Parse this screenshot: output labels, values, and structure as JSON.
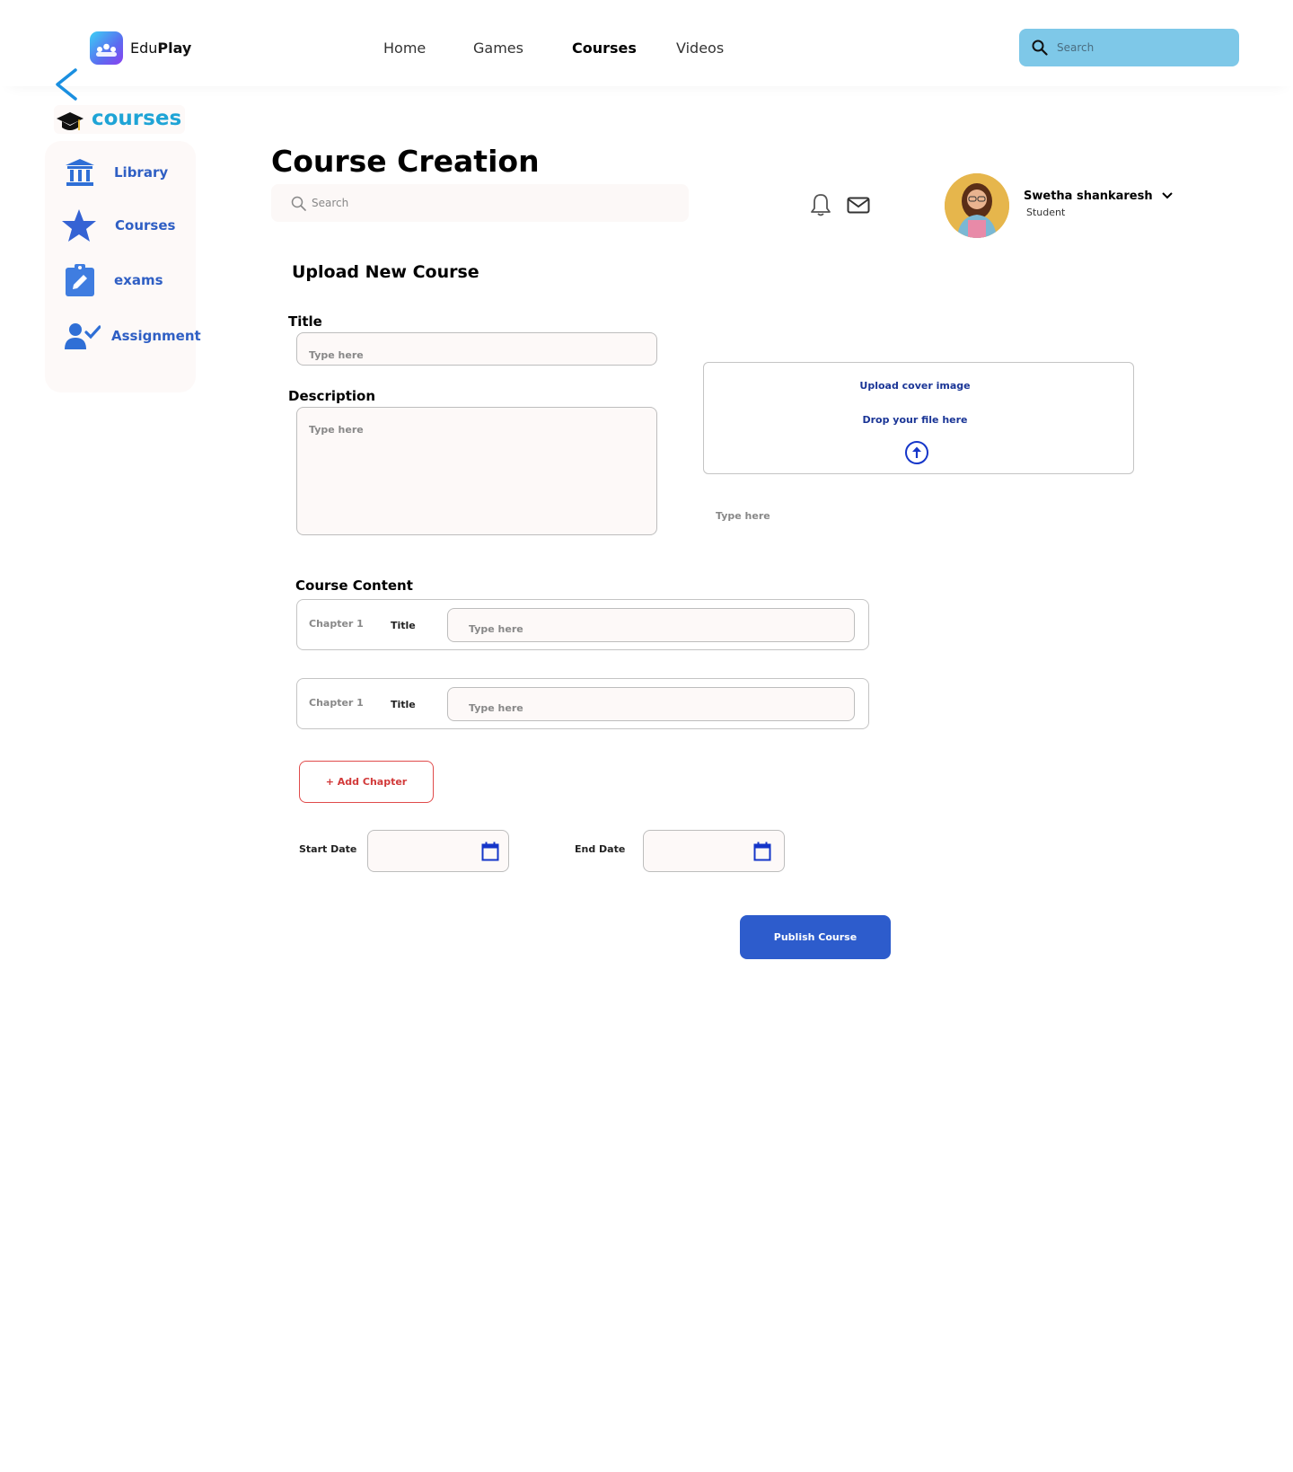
{
  "brand": {
    "name_light": "Edu",
    "name_bold": "Play"
  },
  "nav": {
    "items": [
      "Home",
      "Games",
      "Courses",
      "Videos"
    ],
    "active": "Courses"
  },
  "top_search": {
    "placeholder": "Search"
  },
  "section": {
    "title": "courses"
  },
  "sidebar": {
    "items": [
      {
        "label": "Library",
        "icon": "library-icon"
      },
      {
        "label": "Courses",
        "icon": "star-icon"
      },
      {
        "label": "exams",
        "icon": "clipboard-edit-icon"
      },
      {
        "label": "Assignment",
        "icon": "person-check-icon"
      }
    ]
  },
  "header": {
    "title": "Course Creation",
    "search_placeholder": "Search"
  },
  "user": {
    "name": "Swetha shankaresh",
    "role": "Student"
  },
  "form": {
    "heading": "Upload New Course",
    "title_label": "Title",
    "title_placeholder": "Type here",
    "description_label": "Description",
    "description_placeholder": "Type here",
    "upload": {
      "line1": "Upload cover image",
      "line2": "Drop your file here"
    },
    "upload_caption_placeholder": "Type here",
    "content_label": "Course Content",
    "chapters": [
      {
        "number": "Chapter 1",
        "title_label": "Title",
        "placeholder": "Type here"
      },
      {
        "number": "Chapter 1",
        "title_label": "Title",
        "placeholder": "Type here"
      }
    ],
    "add_chapter": "+ Add Chapter",
    "start_date_label": "Start Date",
    "end_date_label": "End Date",
    "publish": "Publish Course"
  },
  "colors": {
    "accent": "#2d5ccc",
    "section_title": "#1fa4d6",
    "sidebar_text": "#2f5fc4",
    "search_bar": "#7ec8e8",
    "add_chapter": "#d23a3a"
  }
}
